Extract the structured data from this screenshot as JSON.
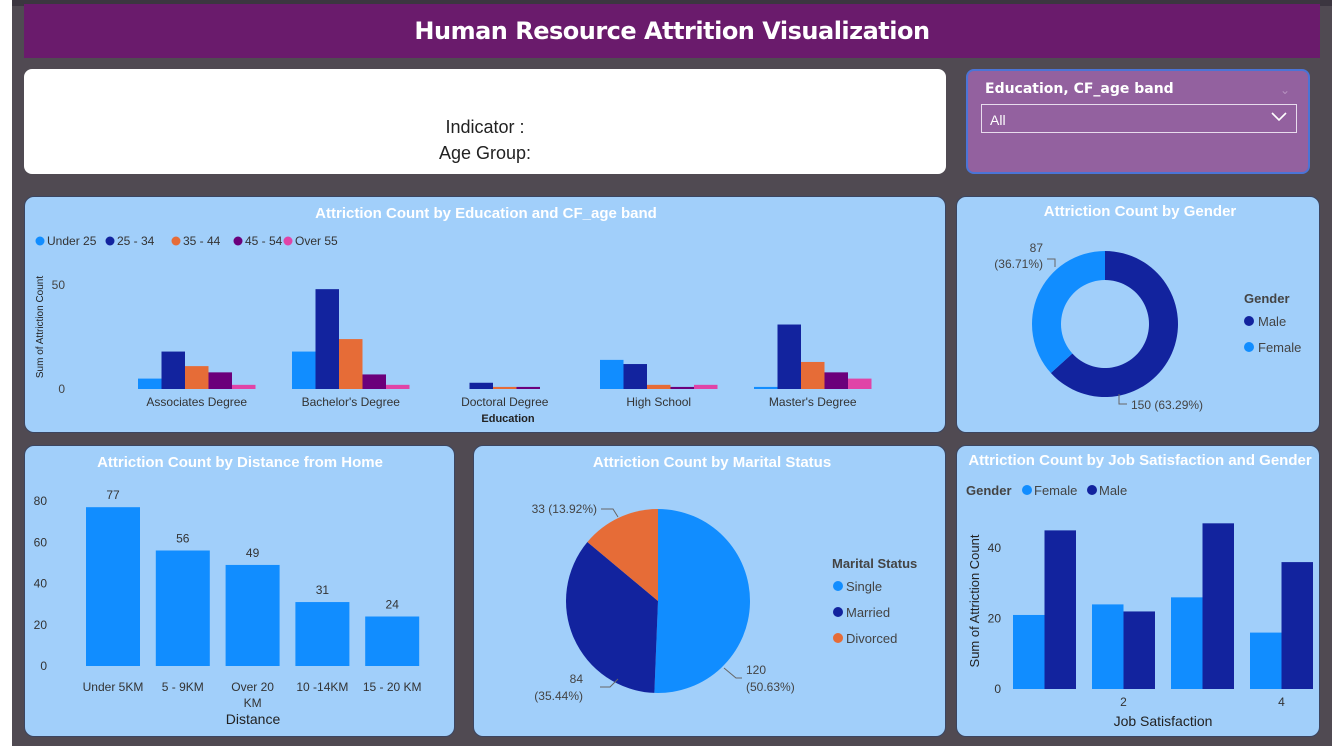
{
  "header": {
    "title": "Human Resource Attrition Visualization"
  },
  "indicator": {
    "line1": "Indicator :",
    "line2": "Age Group:"
  },
  "slicer": {
    "title": "Education, CF_age band",
    "value": "All"
  },
  "colors": {
    "light_blue": "#118dff",
    "dark_blue": "#12239e",
    "orange": "#e66c37",
    "purple": "#6b007b",
    "pink": "#e044a7",
    "card_bg": "#a1cffa",
    "header_bg": "#6a1b6c"
  },
  "chart_data": [
    {
      "id": "edu_age",
      "type": "bar",
      "title": "Attriction Count by Education and CF_age band",
      "xlabel": "Education",
      "ylabel": "Sum of Attriction Count",
      "categories": [
        "Associates Degree",
        "Bachelor's Degree",
        "Doctoral Degree",
        "High School",
        "Master's Degree"
      ],
      "series": [
        {
          "name": "Under 25",
          "values": [
            5,
            18,
            0,
            14,
            1
          ]
        },
        {
          "name": "25 - 34",
          "values": [
            18,
            48,
            3,
            12,
            31
          ]
        },
        {
          "name": "35 - 44",
          "values": [
            11,
            24,
            1,
            2,
            13
          ]
        },
        {
          "name": "45 - 54",
          "values": [
            8,
            7,
            1,
            1,
            8
          ]
        },
        {
          "name": "Over 55",
          "values": [
            2,
            2,
            0,
            2,
            5
          ]
        }
      ],
      "yticks": [
        0,
        50
      ],
      "ylim": [
        0,
        50
      ],
      "legend": "top-left"
    },
    {
      "id": "gender",
      "type": "donut",
      "title": "Attriction Count by Gender",
      "legend_title": "Gender",
      "slices": [
        {
          "name": "Male",
          "value": 150,
          "label": "150 (63.29%)"
        },
        {
          "name": "Female",
          "value": 87,
          "label": "87 (36.71%)"
        }
      ],
      "legend": "right"
    },
    {
      "id": "distance",
      "type": "bar",
      "title": "Attriction Count by Distance from Home",
      "xlabel": "Distance",
      "ylabel": "",
      "categories": [
        "Under 5KM",
        "5 - 9KM",
        "Over 20 KM",
        "10 -14KM",
        "15 - 20 KM"
      ],
      "values": [
        77,
        56,
        49,
        31,
        24
      ],
      "yticks": [
        0,
        20,
        40,
        60,
        80
      ],
      "ylim": [
        0,
        80
      ]
    },
    {
      "id": "marital",
      "type": "pie",
      "title": "Attriction Count by Marital Status",
      "legend_title": "Marital Status",
      "slices": [
        {
          "name": "Single",
          "value": 120,
          "label_value": "120",
          "label_pct": "(50.63%)"
        },
        {
          "name": "Married",
          "value": 84,
          "label_value": "84",
          "label_pct": "(35.44%)"
        },
        {
          "name": "Divorced",
          "value": 33,
          "label_value": "33 (13.92%)",
          "label_pct": ""
        }
      ],
      "legend": "right"
    },
    {
      "id": "jobsat",
      "type": "bar",
      "title": "Attriction Count by Job Satisfaction and Gender",
      "legend_title": "Gender",
      "xlabel": "Job Satisfaction",
      "ylabel": "Sum of Attriction Count",
      "categories": [
        "1",
        "2",
        "3",
        "4"
      ],
      "tick_labels": [
        "",
        "2",
        "",
        "4"
      ],
      "series": [
        {
          "name": "Female",
          "values": [
            21,
            24,
            26,
            16
          ]
        },
        {
          "name": "Male",
          "values": [
            45,
            22,
            47,
            36
          ]
        }
      ],
      "yticks": [
        0,
        20,
        40
      ],
      "ylim": [
        0,
        50
      ],
      "legend": "top-left"
    }
  ]
}
